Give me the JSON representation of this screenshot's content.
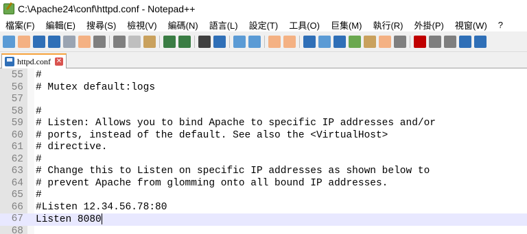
{
  "window": {
    "title": "C:\\Apache24\\conf\\httpd.conf - Notepad++"
  },
  "menu": [
    "檔案(F)",
    "編輯(E)",
    "搜尋(S)",
    "檢視(V)",
    "編碼(N)",
    "語言(L)",
    "設定(T)",
    "工具(O)",
    "巨集(M)",
    "執行(R)",
    "外掛(P)",
    "視窗(W)",
    "?"
  ],
  "toolbar": [
    {
      "name": "new-file-icon",
      "color": "#5b9bd5"
    },
    {
      "name": "open-file-icon",
      "color": "#f4b183"
    },
    {
      "name": "save-icon",
      "color": "#2f6fb7"
    },
    {
      "name": "save-all-icon",
      "color": "#2f6fb7"
    },
    {
      "name": "close-icon",
      "color": "#9aa4b2"
    },
    {
      "name": "close-all-icon",
      "color": "#f4b183"
    },
    {
      "name": "print-icon",
      "color": "#7f7f7f"
    },
    {
      "name": "sep"
    },
    {
      "name": "cut-icon",
      "color": "#7f7f7f"
    },
    {
      "name": "copy-icon",
      "color": "#bfbfbf"
    },
    {
      "name": "paste-icon",
      "color": "#c9a15d"
    },
    {
      "name": "sep"
    },
    {
      "name": "undo-icon",
      "color": "#3a7d44"
    },
    {
      "name": "redo-icon",
      "color": "#3a7d44"
    },
    {
      "name": "sep"
    },
    {
      "name": "find-icon",
      "color": "#404040"
    },
    {
      "name": "replace-icon",
      "color": "#2f6fb7"
    },
    {
      "name": "sep"
    },
    {
      "name": "zoom-in-icon",
      "color": "#5b9bd5"
    },
    {
      "name": "zoom-out-icon",
      "color": "#5b9bd5"
    },
    {
      "name": "sep"
    },
    {
      "name": "sync-vertical-icon",
      "color": "#f4b183"
    },
    {
      "name": "sync-horizontal-icon",
      "color": "#f4b183"
    },
    {
      "name": "sep"
    },
    {
      "name": "word-wrap-icon",
      "color": "#2f6fb7"
    },
    {
      "name": "show-all-chars-icon",
      "color": "#5b9bd5"
    },
    {
      "name": "indent-guide-icon",
      "color": "#2f6fb7"
    },
    {
      "name": "document-map-icon",
      "color": "#6aa84f"
    },
    {
      "name": "function-list-icon",
      "color": "#c9a15d"
    },
    {
      "name": "folder-workspace-icon",
      "color": "#f4b183"
    },
    {
      "name": "monitoring-icon",
      "color": "#7f7f7f"
    },
    {
      "name": "sep"
    },
    {
      "name": "record-macro-icon",
      "color": "#c00000"
    },
    {
      "name": "stop-record-icon",
      "color": "#7f7f7f"
    },
    {
      "name": "playback-macro-icon",
      "color": "#7f7f7f"
    },
    {
      "name": "run-macro-multiple-icon",
      "color": "#2f6fb7"
    },
    {
      "name": "save-macro-icon",
      "color": "#2f6fb7"
    }
  ],
  "tab": {
    "label": "httpd.conf"
  },
  "editor": {
    "lines": [
      {
        "num": "55",
        "text": "#"
      },
      {
        "num": "56",
        "text": "# Mutex default:logs"
      },
      {
        "num": "57",
        "text": ""
      },
      {
        "num": "58",
        "text": "#"
      },
      {
        "num": "59",
        "text": "# Listen: Allows you to bind Apache to specific IP addresses and/or"
      },
      {
        "num": "60",
        "text": "# ports, instead of the default. See also the <VirtualHost>"
      },
      {
        "num": "61",
        "text": "# directive."
      },
      {
        "num": "62",
        "text": "#"
      },
      {
        "num": "63",
        "text": "# Change this to Listen on specific IP addresses as shown below to"
      },
      {
        "num": "64",
        "text": "# prevent Apache from glomming onto all bound IP addresses."
      },
      {
        "num": "65",
        "text": "#"
      },
      {
        "num": "66",
        "text": "#Listen 12.34.56.78:80"
      },
      {
        "num": "67",
        "text": "Listen 8080"
      },
      {
        "num": "68",
        "text": ""
      }
    ],
    "current_line": "67"
  }
}
